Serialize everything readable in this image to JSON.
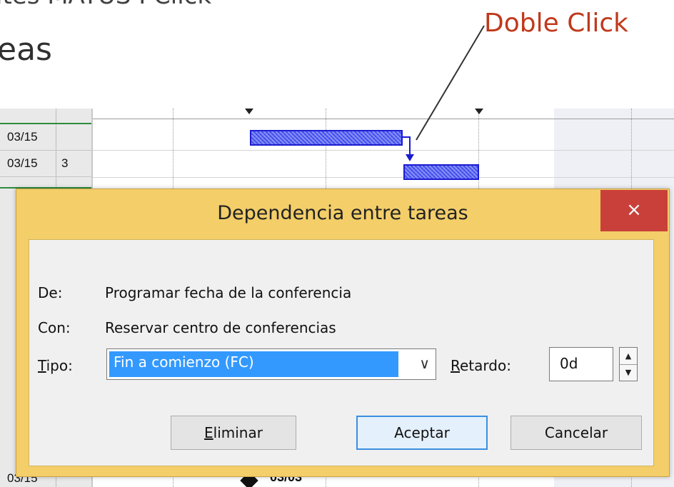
{
  "slide": {
    "line1": "ites MATUS I Click",
    "line2": "eas",
    "annotation": "Doble Click",
    "annotation_color": "#c0391b"
  },
  "project_grid": {
    "rows": [
      {
        "date": "03/15",
        "pred": ""
      },
      {
        "date": "03/15",
        "pred": "3"
      }
    ],
    "bottom_date": "03/15"
  },
  "gantt": {
    "milestone_label": "03/03",
    "bar_color": "#4a57ff"
  },
  "dialog": {
    "title": "Dependencia entre tareas",
    "close_label": "×",
    "from_label": "De:",
    "from_value": "Programar fecha de la conferencia",
    "to_label": "Con:",
    "to_value": "Reservar centro de conferencias",
    "type_label_first": "T",
    "type_label_rest": "ipo:",
    "type_value": "Fin a comienzo (FC)",
    "lag_label_first": "R",
    "lag_label_rest": "etardo:",
    "lag_value": "0d",
    "delete_first": "E",
    "delete_rest": "liminar",
    "ok_label": "Aceptar",
    "cancel_label": "Cancelar",
    "colors": {
      "title_bar": "#f3ce69",
      "close": "#c9403a",
      "selection": "#3399ff"
    }
  }
}
